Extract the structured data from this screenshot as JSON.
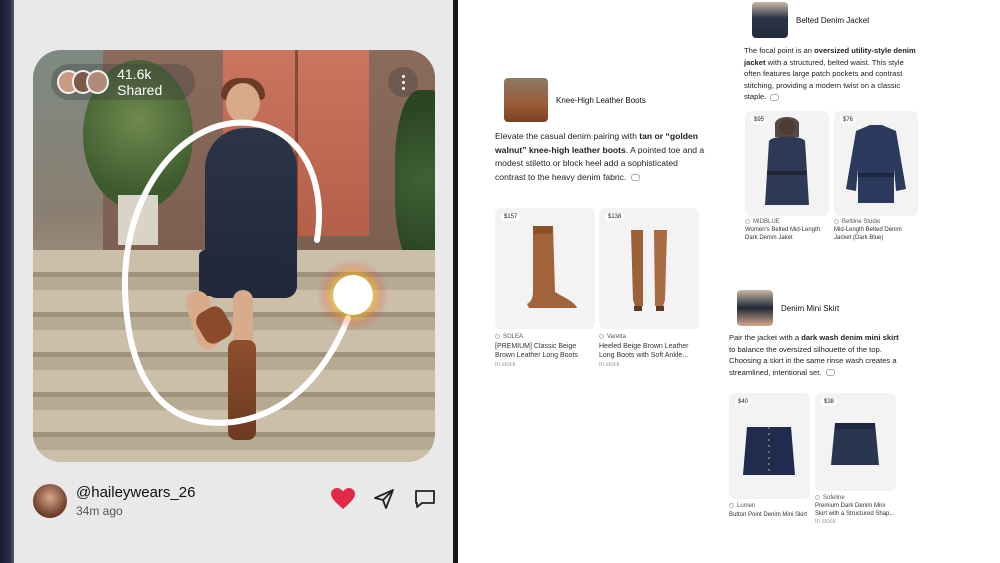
{
  "post": {
    "shared_count": "41.6k Shared",
    "username": "@haileywears_26",
    "time_ago": "34m ago"
  },
  "sections": [
    {
      "title": "Knee-High Leather Boots",
      "description_html": "Elevate the casual denim pairing with <b>tan or “golden walnut” knee-high leather boots</b>. A pointed toe and a modest stiletto or block heel add a sophisticated contrast to the heavy denim fabric.",
      "products": [
        {
          "price": "$157",
          "brand": "SOLEA",
          "name": "[PREMIUM] Classic Beige Brown Leather Long Boots",
          "stock": "In stock"
        },
        {
          "price": "$138",
          "brand": "Varetta",
          "name": "Heeled Beige Brown Leather Long Boots with Soft Ankle...",
          "stock": "In stock"
        }
      ]
    },
    {
      "title": "Belted Denim Jacket",
      "description_html": "The focal point is an <b>oversized utility-style denim jacket</b> with a structured, belted waist. This style often features large patch pockets and contrast stitching, providing a modern twist on a classic staple.",
      "products": [
        {
          "price": "$95",
          "brand": "MIDBLUE",
          "name": "Women's Belted Mid-Length Dark Denim Jaket"
        },
        {
          "price": "$76",
          "brand": "Beltline Studio",
          "name": "Mid-Length Belted Denim Jacket (Dark Blue)"
        }
      ]
    },
    {
      "title": "Denim Mini Skirt",
      "description_html": "Pair the jacket with a <b>dark wash denim mini skirt</b> to balance the oversized silhouette of the top. Choosing a skirt in the same rinse wash creates a streamlined, intentional set.",
      "products": [
        {
          "price": "$40",
          "brand": "Lumen",
          "name": "Button Point Denim Mini Skirt"
        },
        {
          "price": "$38",
          "brand": "Sofeline",
          "name": "Premium Dark Denim Mini Skirt with a Structured Shap...",
          "stock": "In stock"
        }
      ]
    }
  ],
  "icons": [
    "heart-icon",
    "send-icon",
    "comment-icon",
    "more-vertical-icon",
    "link-icon"
  ],
  "colors": {
    "heart": "#e02a48",
    "lens_ring": "#ffffff",
    "page_bg": "#ffffff"
  }
}
